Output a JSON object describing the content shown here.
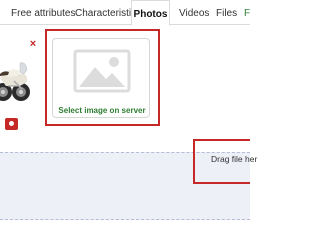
{
  "tabs": [
    {
      "label": "Free attributes",
      "active": false
    },
    {
      "label": "Characteristics",
      "active": false
    },
    {
      "label": "Photos",
      "active": true
    },
    {
      "label": "Videos",
      "active": false
    },
    {
      "label": "Files",
      "active": false
    },
    {
      "label": "F",
      "active": false
    }
  ],
  "photos": {
    "remove_symbol": "×",
    "thumbnail_icon": "motorcycle-photo",
    "action_icon": "gear-icon"
  },
  "server_card": {
    "icon": "image-placeholder-icon",
    "label": "Select image on server"
  },
  "dropzone": {
    "label": "Drag file her"
  },
  "colors": {
    "highlight": "#c62828",
    "accent_green": "#2e7d32",
    "dropzone_bg": "#eef0f8"
  }
}
